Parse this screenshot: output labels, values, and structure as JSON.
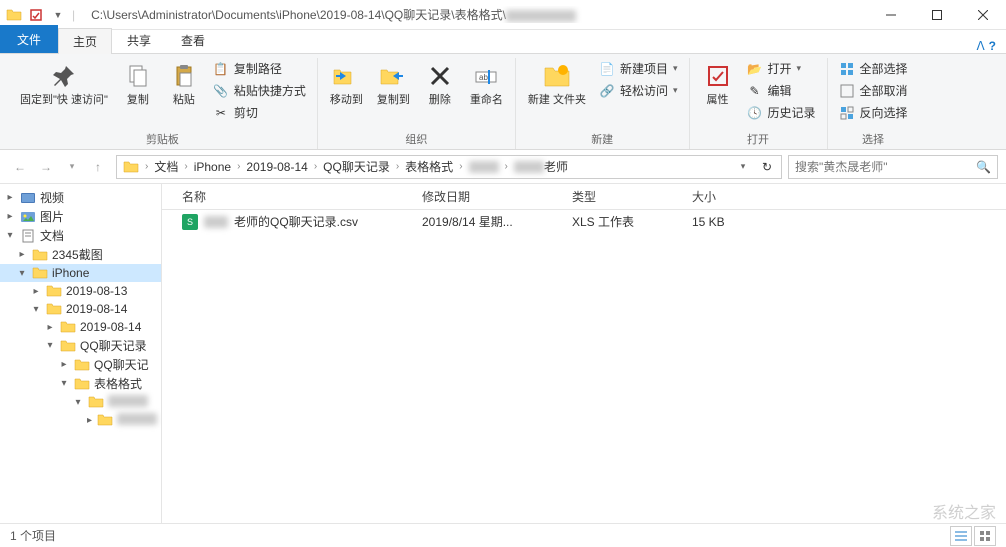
{
  "titlebar": {
    "path": "C:\\Users\\Administrator\\Documents\\iPhone\\2019-08-14\\QQ聊天记录\\表格格式\\"
  },
  "tabs": {
    "file": "文件",
    "home": "主页",
    "share": "共享",
    "view": "查看"
  },
  "ribbon": {
    "pin": "固定到\"快\n速访问\"",
    "copy": "复制",
    "paste": "粘贴",
    "copy_path": "复制路径",
    "paste_shortcut": "粘贴快捷方式",
    "cut": "剪切",
    "clipboard_group": "剪贴板",
    "move_to": "移动到",
    "copy_to": "复制到",
    "delete": "删除",
    "rename": "重命名",
    "organize_group": "组织",
    "new_folder": "新建\n文件夹",
    "new_item": "新建项目",
    "easy_access": "轻松访问",
    "new_group": "新建",
    "properties": "属性",
    "open": "打开",
    "edit": "编辑",
    "history": "历史记录",
    "open_group": "打开",
    "select_all": "全部选择",
    "select_none": "全部取消",
    "invert_selection": "反向选择",
    "select_group": "选择"
  },
  "breadcrumb": {
    "items": [
      "文档",
      "iPhone",
      "2019-08-14",
      "QQ聊天记录",
      "表格格式",
      "",
      "老师"
    ]
  },
  "search": {
    "placeholder": "搜索\"黄杰晟老师\""
  },
  "tree": {
    "items": [
      {
        "label": "视频",
        "icon": "video",
        "indent": 0,
        "expanded": false
      },
      {
        "label": "图片",
        "icon": "pictures",
        "indent": 0,
        "expanded": false
      },
      {
        "label": "文档",
        "icon": "documents",
        "indent": 0,
        "expanded": true,
        "selected": false
      },
      {
        "label": "2345截图",
        "icon": "folder",
        "indent": 1,
        "expanded": false
      },
      {
        "label": "iPhone",
        "icon": "folder",
        "indent": 1,
        "expanded": true,
        "selected": true
      },
      {
        "label": "2019-08-13",
        "icon": "folder",
        "indent": 2,
        "expanded": false
      },
      {
        "label": "2019-08-14",
        "icon": "folder",
        "indent": 2,
        "expanded": true
      },
      {
        "label": "2019-08-14",
        "icon": "folder",
        "indent": 3,
        "expanded": false
      },
      {
        "label": "QQ聊天记录",
        "icon": "folder",
        "indent": 3,
        "expanded": true
      },
      {
        "label": "QQ聊天记",
        "icon": "folder",
        "indent": 4,
        "expanded": false
      },
      {
        "label": "表格格式",
        "icon": "folder",
        "indent": 4,
        "expanded": true
      },
      {
        "label": "",
        "icon": "folder",
        "indent": 5,
        "expanded": true,
        "blurred": true
      },
      {
        "label": "",
        "icon": "folder",
        "indent": 6,
        "expanded": false,
        "blurred": true
      }
    ]
  },
  "filelist": {
    "headers": {
      "name": "名称",
      "date": "修改日期",
      "type": "类型",
      "size": "大小"
    },
    "rows": [
      {
        "name": "老师的QQ聊天记录.csv",
        "name_prefix_blurred": true,
        "date": "2019/8/14 星期...",
        "type": "XLS 工作表",
        "size": "15 KB"
      }
    ]
  },
  "statusbar": {
    "count": "1 个项目"
  },
  "watermark": "系统之家"
}
